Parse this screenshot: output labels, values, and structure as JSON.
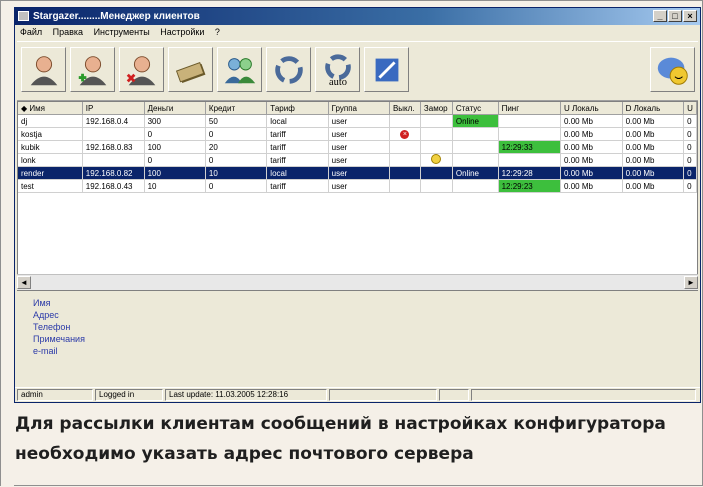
{
  "window": {
    "title": "Stargazer........Менеджер клиентов",
    "btn_min": "_",
    "btn_max": "□",
    "btn_close": "×"
  },
  "menu": [
    "Файл",
    "Правка",
    "Инструменты",
    "Настройки",
    "?"
  ],
  "toolbar": {
    "buttons": [
      {
        "icon": "user-icon"
      },
      {
        "icon": "add-user-icon"
      },
      {
        "icon": "delete-user-icon"
      },
      {
        "icon": "payment-icon"
      },
      {
        "icon": "group-users-icon"
      },
      {
        "icon": "refresh-icon"
      },
      {
        "icon": "auto-refresh-icon",
        "label": "auto"
      },
      {
        "icon": "edit-icon"
      },
      {
        "icon": "chat-icon"
      }
    ]
  },
  "table": {
    "columns": [
      "Имя",
      "IP",
      "Деньги",
      "Кредит",
      "Тариф",
      "Группа",
      "Выкл.",
      "Замор",
      "Статус",
      "Пинг",
      "U Локаль",
      "D Локаль",
      "U"
    ],
    "rows": [
      {
        "name": "dj",
        "ip": "192.168.0.4",
        "money": "300",
        "credit": "50",
        "tariff": "local",
        "group": "user",
        "off": "",
        "frozen": "",
        "status": "Online",
        "ping": "",
        "u_local": "0.00 Mb",
        "d_local": "0.00 Mb",
        "u": "0"
      },
      {
        "name": "kostja",
        "ip": "",
        "money": "0",
        "credit": "0",
        "tariff": "tariff",
        "group": "user",
        "off": "x",
        "frozen": "",
        "status": "",
        "ping": "",
        "u_local": "0.00 Mb",
        "d_local": "0.00 Mb",
        "u": "0"
      },
      {
        "name": "kubik",
        "ip": "192.168.0.83",
        "money": "100",
        "credit": "20",
        "tariff": "tariff",
        "group": "user",
        "off": "",
        "frozen": "",
        "status": "",
        "ping": "12:29:33",
        "u_local": "0.00 Mb",
        "d_local": "0.00 Mb",
        "u": "0"
      },
      {
        "name": "lonk",
        "ip": "",
        "money": "0",
        "credit": "0",
        "tariff": "tariff",
        "group": "user",
        "off": "",
        "frozen": "z",
        "status": "",
        "ping": "",
        "u_local": "0.00 Mb",
        "d_local": "0.00 Mb",
        "u": "0"
      },
      {
        "name": "render",
        "ip": "192.168.0.82",
        "money": "100",
        "credit": "10",
        "tariff": "local",
        "group": "user",
        "off": "",
        "frozen": "",
        "status": "Online",
        "ping": "12:29:28",
        "u_local": "0.00 Mb",
        "d_local": "0.00 Mb",
        "u": "0",
        "selected": true
      },
      {
        "name": "test",
        "ip": "192.168.0.43",
        "money": "10",
        "credit": "0",
        "tariff": "tariff",
        "group": "user",
        "off": "",
        "frozen": "",
        "status": "",
        "ping": "12:29:23",
        "u_local": "0.00 Mb",
        "d_local": "0.00 Mb",
        "u": "0"
      }
    ]
  },
  "details": [
    "Имя",
    "Адрес",
    "Телефон",
    "Примечания",
    "e-mail"
  ],
  "statusbar": {
    "user": "admin",
    "state": "Logged in",
    "update": "Last update: 11.03.2005 12:28:16"
  },
  "caption": "Для рассылки клиентам сообщений в настройках конфигуратора необходимо указать адрес почтового сервера",
  "colors": {
    "online": "#3dbf3d",
    "selected_row": "#0a246a",
    "group_highlight": "#f08080",
    "link": "#2b3aa8"
  }
}
